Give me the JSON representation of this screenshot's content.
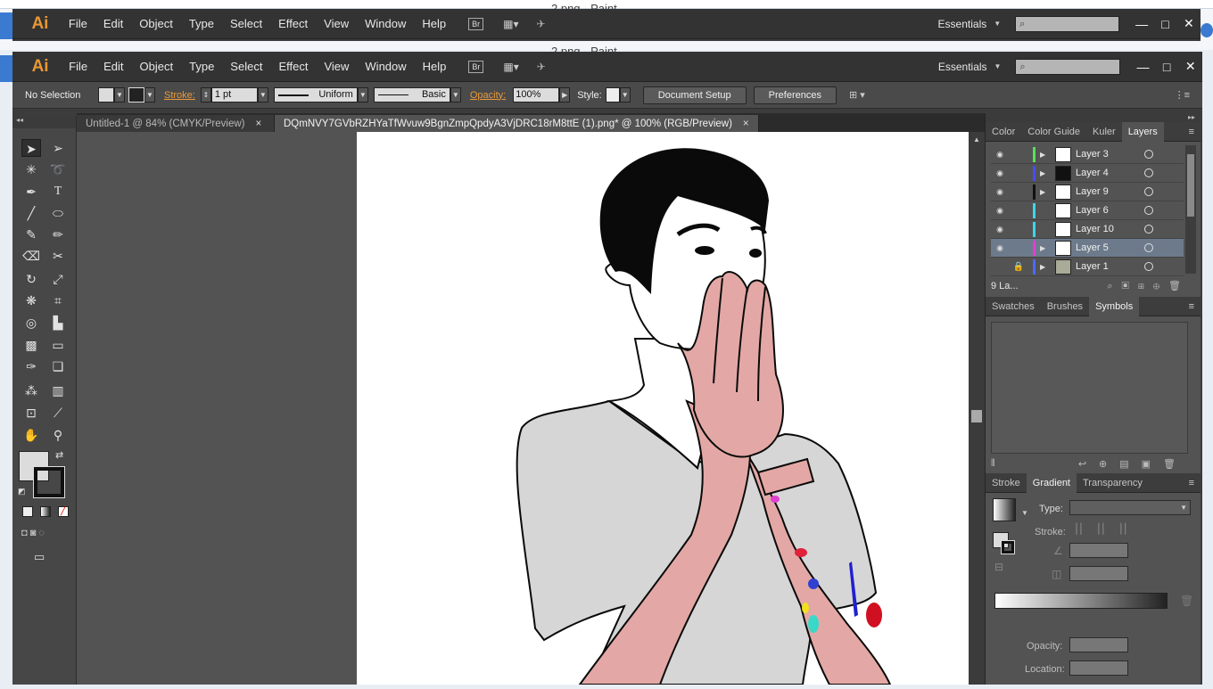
{
  "background_app": {
    "title_back": "2.png - Paint",
    "title_front": "2.png - Paint"
  },
  "app": {
    "logo": "Ai"
  },
  "menu": [
    "File",
    "Edit",
    "Object",
    "Type",
    "Select",
    "Effect",
    "View",
    "Window",
    "Help"
  ],
  "appbar": {
    "bridge": "Br",
    "workspace": "Essentials",
    "search_placeholder": ""
  },
  "control": {
    "selection": "No Selection",
    "stroke_label": "Stroke:",
    "stroke_weight": "1 pt",
    "profile": "Uniform",
    "brush": "Basic",
    "opacity_label": "Opacity:",
    "opacity_value": "100%",
    "style_label": "Style:",
    "doc_setup": "Document Setup",
    "preferences": "Preferences"
  },
  "tabs": [
    {
      "label": "Untitled-1 @ 84% (CMYK/Preview)",
      "close": "×"
    },
    {
      "label": "DQmNVY7GVbRZHYaTfWvuw9BgnZmpQpdyA3VjDRC18rM8ttE (1).png* @ 100% (RGB/Preview)",
      "close": "×"
    }
  ],
  "layers_panel": {
    "tabs": [
      "Color",
      "Color Guide",
      "Kuler",
      "Layers"
    ],
    "count": "9 La...",
    "layers": [
      {
        "name": "Layer 3",
        "color": "#58e058",
        "expand": true,
        "locked": false
      },
      {
        "name": "Layer 4",
        "color": "#4a4aff",
        "expand": true,
        "locked": false
      },
      {
        "name": "Layer 9",
        "color": "#111111",
        "expand": true,
        "locked": false
      },
      {
        "name": "Layer 6",
        "color": "#3ad8e8",
        "expand": false,
        "locked": false
      },
      {
        "name": "Layer 10",
        "color": "#3ad8e8",
        "expand": false,
        "locked": false
      },
      {
        "name": "Layer 5",
        "color": "#e040d0",
        "expand": true,
        "locked": false,
        "selected": true
      },
      {
        "name": "Layer 1",
        "color": "#4a6aff",
        "expand": true,
        "locked": true
      }
    ]
  },
  "symbols_panel": {
    "tabs": [
      "Swatches",
      "Brushes",
      "Symbols"
    ]
  },
  "gradient_panel": {
    "tabs": [
      "Stroke",
      "Gradient",
      "Transparency"
    ],
    "type_label": "Type:",
    "stroke_label": "Stroke:",
    "opacity_label": "Opacity:",
    "location_label": "Location:"
  },
  "colors": {
    "skin": "#e3a8a5",
    "shirt": "#d6d6d6",
    "hair": "#0a0a0a",
    "accent": "#e79834"
  }
}
